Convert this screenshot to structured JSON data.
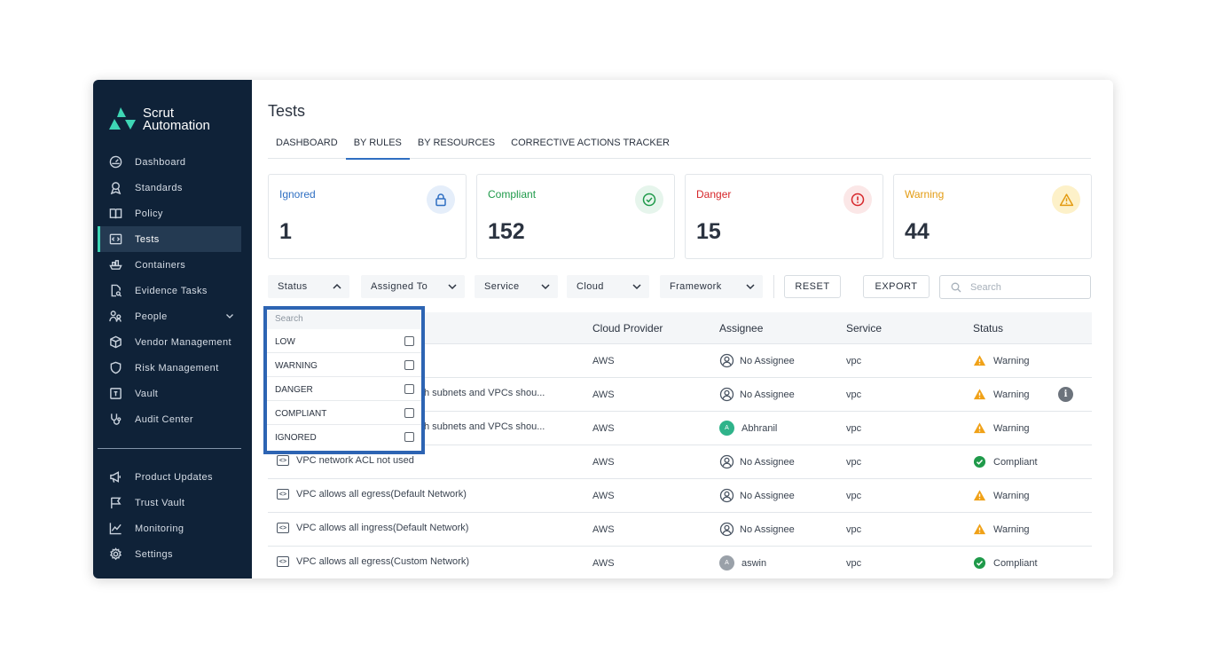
{
  "brand": {
    "line1": "Scrut",
    "line2": "Automation"
  },
  "sidebar": {
    "items": [
      {
        "label": "Dashboard",
        "icon": "dashboard-icon"
      },
      {
        "label": "Standards",
        "icon": "award-icon"
      },
      {
        "label": "Policy",
        "icon": "book-icon"
      },
      {
        "label": "Tests",
        "icon": "code-icon",
        "active": true
      },
      {
        "label": "Containers",
        "icon": "ship-icon"
      },
      {
        "label": "Evidence Tasks",
        "icon": "file-search-icon"
      },
      {
        "label": "People",
        "icon": "people-icon"
      },
      {
        "label": "Vendor Management",
        "icon": "box-icon"
      },
      {
        "label": "Risk Management",
        "icon": "shield-icon"
      },
      {
        "label": "Vault",
        "icon": "vault-icon"
      },
      {
        "label": "Audit Center",
        "icon": "stethoscope-icon"
      }
    ],
    "bottom_items": [
      {
        "label": "Product Updates",
        "icon": "megaphone-icon"
      },
      {
        "label": "Trust Vault",
        "icon": "flag-icon"
      },
      {
        "label": "Monitoring",
        "icon": "chart-line-icon"
      },
      {
        "label": "Settings",
        "icon": "gear-icon"
      }
    ]
  },
  "page": {
    "title": "Tests"
  },
  "tabs": [
    "DASHBOARD",
    "BY RULES",
    "BY RESOURCES",
    "CORRECTIVE ACTIONS TRACKER"
  ],
  "active_tab": "BY RULES",
  "cards": [
    {
      "label": "Ignored",
      "count": "1",
      "color": "#2f6fc2",
      "icon": "lock-icon"
    },
    {
      "label": "Compliant",
      "count": "152",
      "color": "#1f9a4a",
      "icon": "check-circle-icon"
    },
    {
      "label": "Danger",
      "count": "15",
      "color": "#d6262a",
      "icon": "alert-circle-icon"
    },
    {
      "label": "Warning",
      "count": "44",
      "color": "#e39b12",
      "icon": "warning-triangle-icon"
    }
  ],
  "filters": {
    "status": "Status",
    "assigned_to": "Assigned To",
    "service": "Service",
    "cloud": "Cloud",
    "framework": "Framework",
    "reset": "RESET",
    "export": "EXPORT",
    "search_placeholder": "Search"
  },
  "dropdown": {
    "search_placeholder": "Search",
    "options": [
      "LOW",
      "WARNING",
      "DANGER",
      "COMPLIANT",
      "IGNORED"
    ]
  },
  "table": {
    "headers": {
      "cloud": "Cloud Provider",
      "assignee": "Assignee",
      "service": "Service",
      "status": "Status"
    },
    "rows": [
      {
        "test": "",
        "cloud": "AWS",
        "assignee": "No Assignee",
        "service": "vpc",
        "status": "Warning"
      },
      {
        "test": "h subnets and VPCs shou...",
        "cloud": "AWS",
        "assignee": "No Assignee",
        "service": "vpc",
        "status": "Warning"
      },
      {
        "test": "h subnets and VPCs shou...",
        "cloud": "AWS",
        "assignee": "Abhranil",
        "avatar": "A",
        "service": "vpc",
        "status": "Warning"
      },
      {
        "test": "VPC network ACL not used",
        "cloud": "AWS",
        "assignee": "No Assignee",
        "service": "vpc",
        "status": "Compliant"
      },
      {
        "test": "VPC allows all egress(Default Network)",
        "cloud": "AWS",
        "assignee": "No Assignee",
        "service": "vpc",
        "status": "Warning"
      },
      {
        "test": "VPC allows all ingress(Default Network)",
        "cloud": "AWS",
        "assignee": "No Assignee",
        "service": "vpc",
        "status": "Warning"
      },
      {
        "test": "VPC allows all egress(Custom Network)",
        "cloud": "AWS",
        "assignee": "aswin",
        "avatar": "A",
        "service": "vpc",
        "status": "Compliant"
      }
    ]
  },
  "icons": {
    "test_icon": "<>",
    "info_icon": "i"
  }
}
